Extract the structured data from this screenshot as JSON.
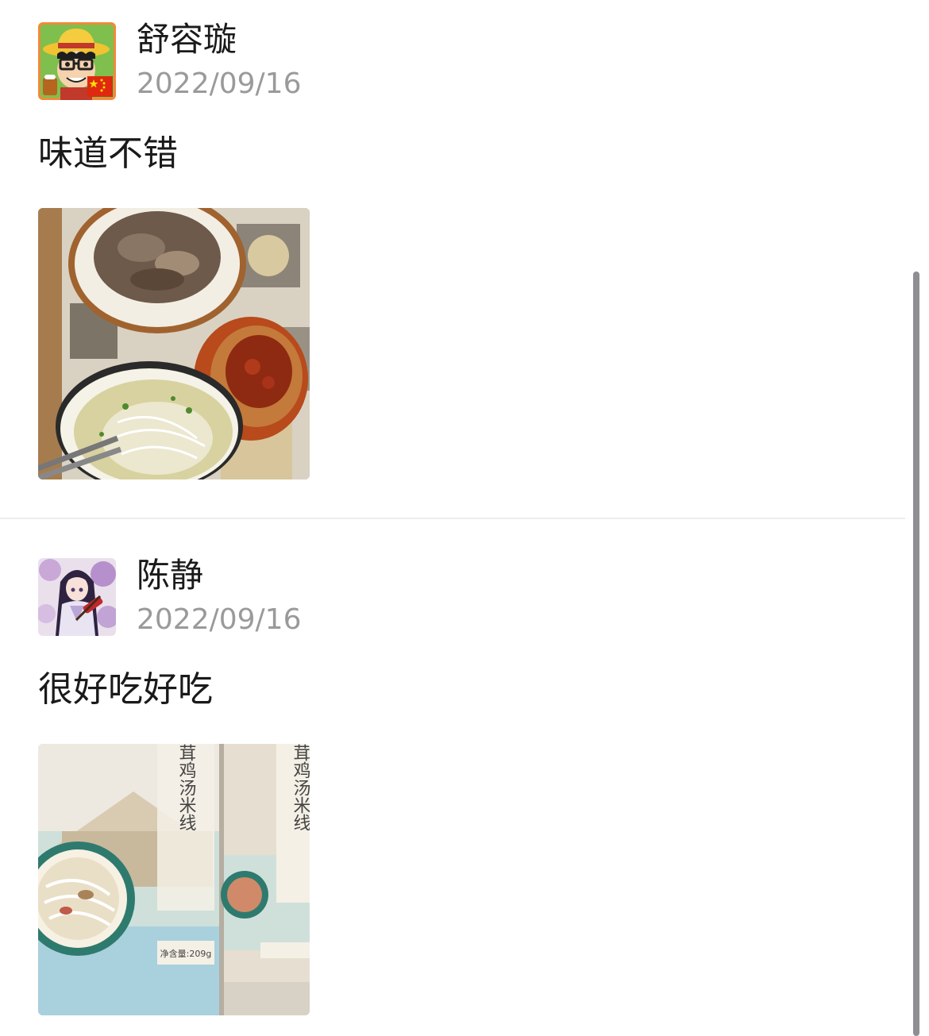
{
  "reviews": [
    {
      "user_name": "舒容璇",
      "date": "2022/09/16",
      "text": "味道不错",
      "avatar_icon": "cartoon-straw-hat-avatar-icon",
      "photo": "noodle-soup-meat-chili-photo"
    },
    {
      "user_name": "陈静",
      "date": "2022/09/16",
      "text": "很好吃好吃",
      "avatar_icon": "anime-girl-avatar-icon",
      "photo": "rice-noodle-package-photo"
    }
  ],
  "photo_texts": {
    "package_title": "云南松茸鸡汤米线",
    "net_weight": "净含量:209g"
  },
  "colors": {
    "name_text": "#1a1a1a",
    "date_text": "#9a9a9a",
    "divider": "#eeeeee",
    "scrollbar": "#8e8e93"
  }
}
